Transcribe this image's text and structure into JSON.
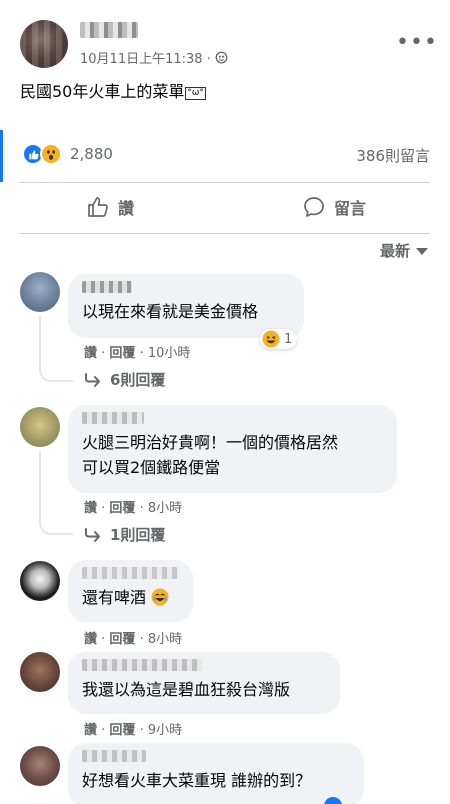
{
  "post": {
    "timestamp": "10月11日上午11:38 ·",
    "text": "民國50年火車上的菜單",
    "text_emoji": "°ω°",
    "reaction_count": "2,880",
    "comment_count": "386則留言"
  },
  "actions": {
    "like_label": "讚",
    "comment_label": "留言"
  },
  "sort": {
    "label": "最新"
  },
  "comments": [
    {
      "text_lines": [
        "以現在來看就是美金價格"
      ],
      "like": "讚",
      "reply": "回覆",
      "time": "10小時",
      "reaction_count": "1",
      "replies_label": "6則回覆"
    },
    {
      "text_lines": [
        "火腿三明治好貴啊！一個的價格居然",
        "可以買2個鐵路便當"
      ],
      "like": "讚",
      "reply": "回覆",
      "time": "8小時",
      "replies_label": "1則回覆"
    },
    {
      "text_lines": [
        "還有啤酒"
      ],
      "like": "讚",
      "reply": "回覆",
      "time": "8小時"
    },
    {
      "text_lines": [
        "我還以為這是碧血狂殺台灣版"
      ],
      "like": "讚",
      "reply": "回覆",
      "time": "9小時"
    },
    {
      "text_lines": [
        "好想看火車大菜重現 誰辦的到？"
      ]
    }
  ],
  "colors": {
    "accent": "#1877f2",
    "secondary_text": "#65676b",
    "bubble": "#f0f2f5"
  }
}
